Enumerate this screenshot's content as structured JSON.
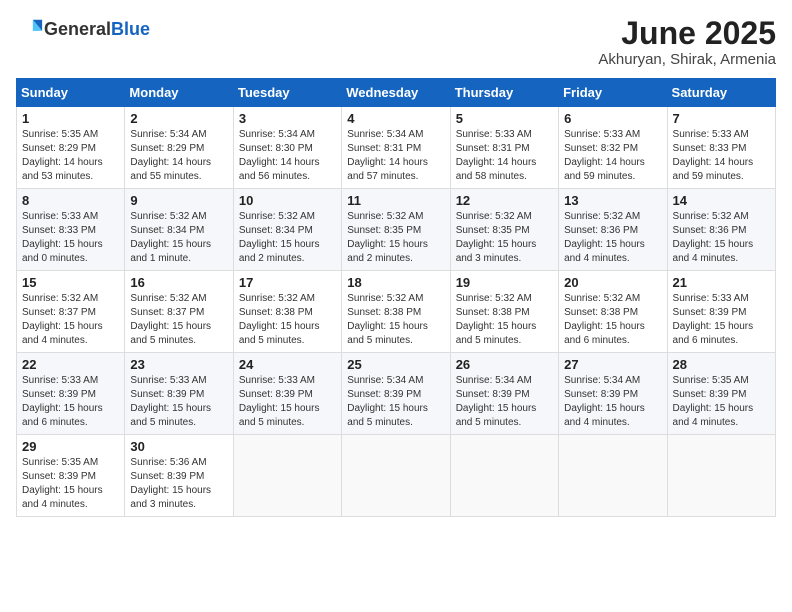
{
  "header": {
    "logo_general": "General",
    "logo_blue": "Blue",
    "month": "June 2025",
    "location": "Akhuryan, Shirak, Armenia"
  },
  "weekdays": [
    "Sunday",
    "Monday",
    "Tuesday",
    "Wednesday",
    "Thursday",
    "Friday",
    "Saturday"
  ],
  "weeks": [
    [
      {
        "day": "1",
        "sunrise": "Sunrise: 5:35 AM",
        "sunset": "Sunset: 8:29 PM",
        "daylight": "Daylight: 14 hours and 53 minutes."
      },
      {
        "day": "2",
        "sunrise": "Sunrise: 5:34 AM",
        "sunset": "Sunset: 8:29 PM",
        "daylight": "Daylight: 14 hours and 55 minutes."
      },
      {
        "day": "3",
        "sunrise": "Sunrise: 5:34 AM",
        "sunset": "Sunset: 8:30 PM",
        "daylight": "Daylight: 14 hours and 56 minutes."
      },
      {
        "day": "4",
        "sunrise": "Sunrise: 5:34 AM",
        "sunset": "Sunset: 8:31 PM",
        "daylight": "Daylight: 14 hours and 57 minutes."
      },
      {
        "day": "5",
        "sunrise": "Sunrise: 5:33 AM",
        "sunset": "Sunset: 8:31 PM",
        "daylight": "Daylight: 14 hours and 58 minutes."
      },
      {
        "day": "6",
        "sunrise": "Sunrise: 5:33 AM",
        "sunset": "Sunset: 8:32 PM",
        "daylight": "Daylight: 14 hours and 59 minutes."
      },
      {
        "day": "7",
        "sunrise": "Sunrise: 5:33 AM",
        "sunset": "Sunset: 8:33 PM",
        "daylight": "Daylight: 14 hours and 59 minutes."
      }
    ],
    [
      {
        "day": "8",
        "sunrise": "Sunrise: 5:33 AM",
        "sunset": "Sunset: 8:33 PM",
        "daylight": "Daylight: 15 hours and 0 minutes."
      },
      {
        "day": "9",
        "sunrise": "Sunrise: 5:32 AM",
        "sunset": "Sunset: 8:34 PM",
        "daylight": "Daylight: 15 hours and 1 minute."
      },
      {
        "day": "10",
        "sunrise": "Sunrise: 5:32 AM",
        "sunset": "Sunset: 8:34 PM",
        "daylight": "Daylight: 15 hours and 2 minutes."
      },
      {
        "day": "11",
        "sunrise": "Sunrise: 5:32 AM",
        "sunset": "Sunset: 8:35 PM",
        "daylight": "Daylight: 15 hours and 2 minutes."
      },
      {
        "day": "12",
        "sunrise": "Sunrise: 5:32 AM",
        "sunset": "Sunset: 8:35 PM",
        "daylight": "Daylight: 15 hours and 3 minutes."
      },
      {
        "day": "13",
        "sunrise": "Sunrise: 5:32 AM",
        "sunset": "Sunset: 8:36 PM",
        "daylight": "Daylight: 15 hours and 4 minutes."
      },
      {
        "day": "14",
        "sunrise": "Sunrise: 5:32 AM",
        "sunset": "Sunset: 8:36 PM",
        "daylight": "Daylight: 15 hours and 4 minutes."
      }
    ],
    [
      {
        "day": "15",
        "sunrise": "Sunrise: 5:32 AM",
        "sunset": "Sunset: 8:37 PM",
        "daylight": "Daylight: 15 hours and 4 minutes."
      },
      {
        "day": "16",
        "sunrise": "Sunrise: 5:32 AM",
        "sunset": "Sunset: 8:37 PM",
        "daylight": "Daylight: 15 hours and 5 minutes."
      },
      {
        "day": "17",
        "sunrise": "Sunrise: 5:32 AM",
        "sunset": "Sunset: 8:38 PM",
        "daylight": "Daylight: 15 hours and 5 minutes."
      },
      {
        "day": "18",
        "sunrise": "Sunrise: 5:32 AM",
        "sunset": "Sunset: 8:38 PM",
        "daylight": "Daylight: 15 hours and 5 minutes."
      },
      {
        "day": "19",
        "sunrise": "Sunrise: 5:32 AM",
        "sunset": "Sunset: 8:38 PM",
        "daylight": "Daylight: 15 hours and 5 minutes."
      },
      {
        "day": "20",
        "sunrise": "Sunrise: 5:32 AM",
        "sunset": "Sunset: 8:38 PM",
        "daylight": "Daylight: 15 hours and 6 minutes."
      },
      {
        "day": "21",
        "sunrise": "Sunrise: 5:33 AM",
        "sunset": "Sunset: 8:39 PM",
        "daylight": "Daylight: 15 hours and 6 minutes."
      }
    ],
    [
      {
        "day": "22",
        "sunrise": "Sunrise: 5:33 AM",
        "sunset": "Sunset: 8:39 PM",
        "daylight": "Daylight: 15 hours and 6 minutes."
      },
      {
        "day": "23",
        "sunrise": "Sunrise: 5:33 AM",
        "sunset": "Sunset: 8:39 PM",
        "daylight": "Daylight: 15 hours and 5 minutes."
      },
      {
        "day": "24",
        "sunrise": "Sunrise: 5:33 AM",
        "sunset": "Sunset: 8:39 PM",
        "daylight": "Daylight: 15 hours and 5 minutes."
      },
      {
        "day": "25",
        "sunrise": "Sunrise: 5:34 AM",
        "sunset": "Sunset: 8:39 PM",
        "daylight": "Daylight: 15 hours and 5 minutes."
      },
      {
        "day": "26",
        "sunrise": "Sunrise: 5:34 AM",
        "sunset": "Sunset: 8:39 PM",
        "daylight": "Daylight: 15 hours and 5 minutes."
      },
      {
        "day": "27",
        "sunrise": "Sunrise: 5:34 AM",
        "sunset": "Sunset: 8:39 PM",
        "daylight": "Daylight: 15 hours and 4 minutes."
      },
      {
        "day": "28",
        "sunrise": "Sunrise: 5:35 AM",
        "sunset": "Sunset: 8:39 PM",
        "daylight": "Daylight: 15 hours and 4 minutes."
      }
    ],
    [
      {
        "day": "29",
        "sunrise": "Sunrise: 5:35 AM",
        "sunset": "Sunset: 8:39 PM",
        "daylight": "Daylight: 15 hours and 4 minutes."
      },
      {
        "day": "30",
        "sunrise": "Sunrise: 5:36 AM",
        "sunset": "Sunset: 8:39 PM",
        "daylight": "Daylight: 15 hours and 3 minutes."
      },
      null,
      null,
      null,
      null,
      null
    ]
  ]
}
